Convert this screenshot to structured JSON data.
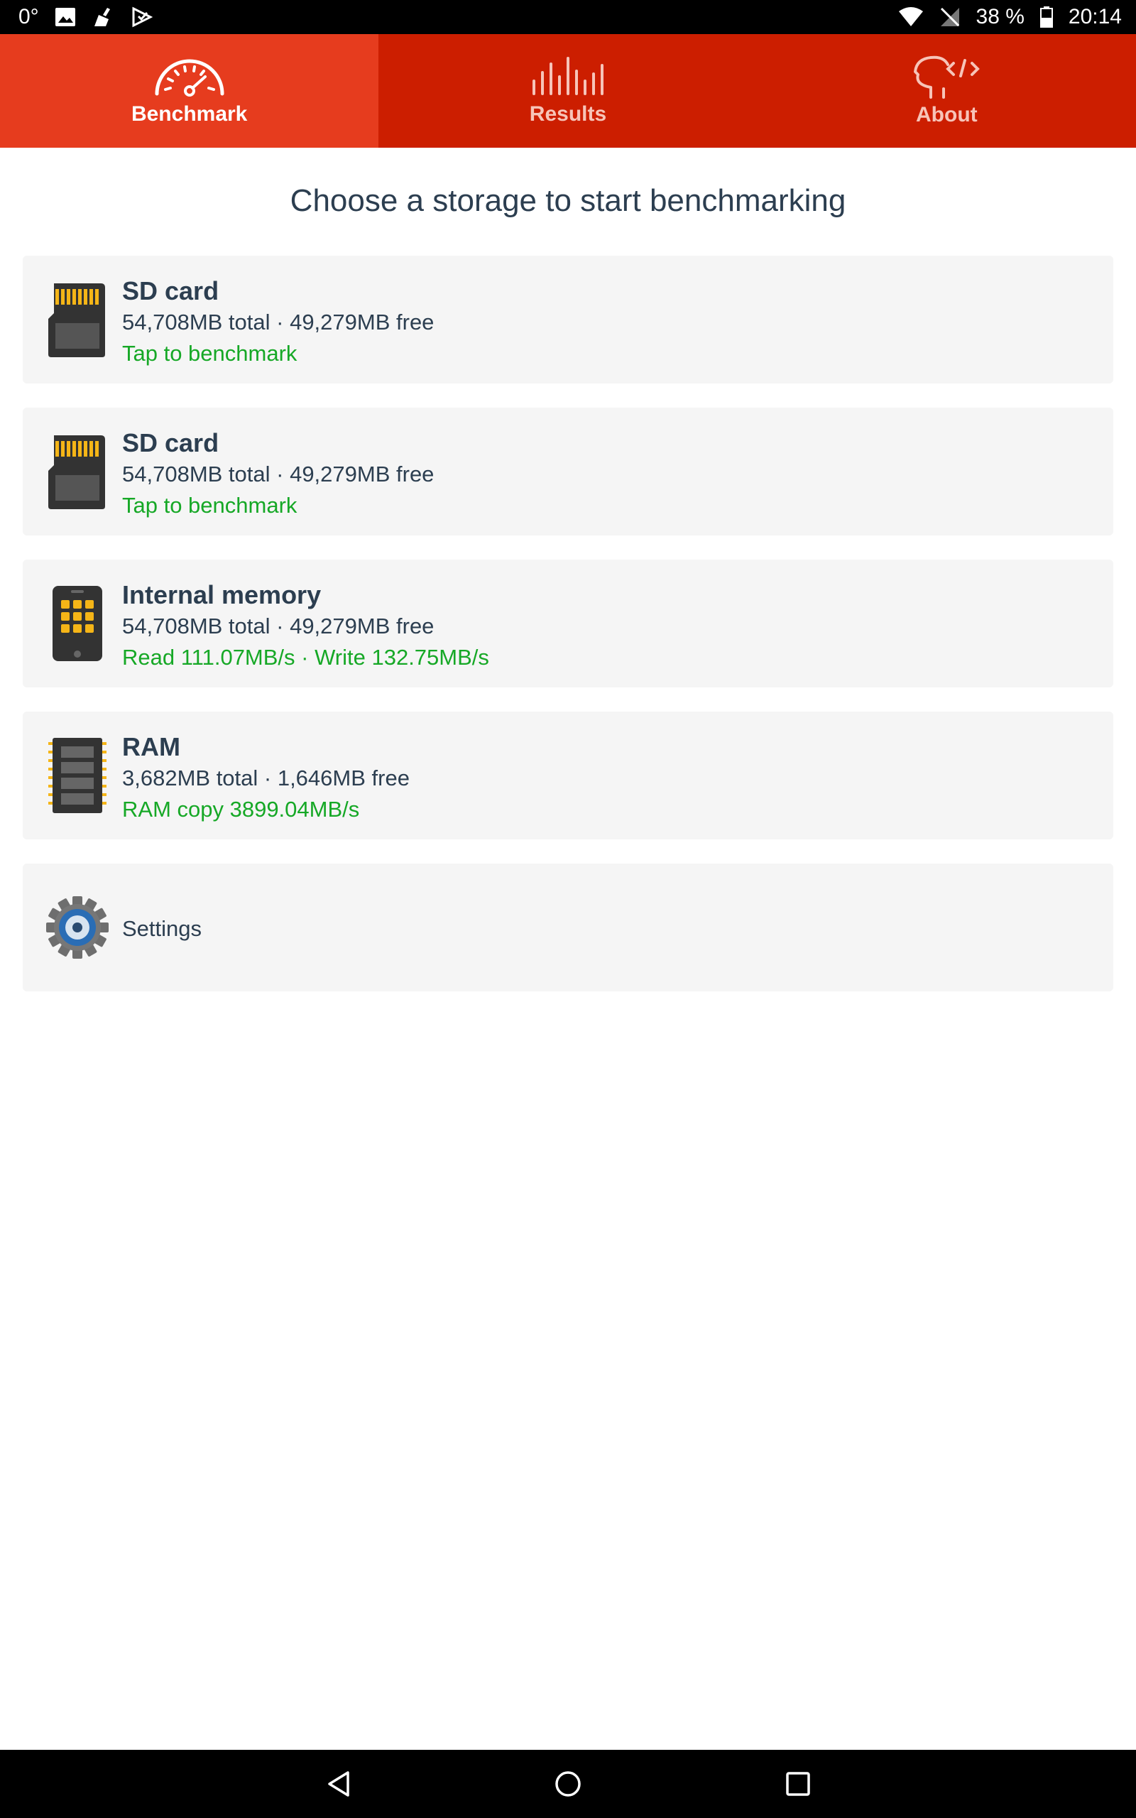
{
  "status_bar": {
    "temperature": "0°",
    "battery": "38 %",
    "time": "20:14"
  },
  "tabs": [
    {
      "label": "Benchmark",
      "icon": "speedometer-icon",
      "active": true
    },
    {
      "label": "Results",
      "icon": "bar-chart-icon",
      "active": false
    },
    {
      "label": "About",
      "icon": "head-code-icon",
      "active": false
    }
  ],
  "main": {
    "title": "Choose a storage to start benchmarking",
    "items": [
      {
        "name": "SD card",
        "detail": "54,708MB total · 49,279MB free",
        "status": "Tap to benchmark",
        "icon": "sd-card-icon"
      },
      {
        "name": "SD card",
        "detail": "54,708MB total · 49,279MB free",
        "status": "Tap to benchmark",
        "icon": "sd-card-icon"
      },
      {
        "name": "Internal memory",
        "detail": "54,708MB total · 49,279MB free",
        "status": "Read 111.07MB/s · Write 132.75MB/s",
        "icon": "phone-memory-icon"
      },
      {
        "name": "RAM",
        "detail": "3,682MB total · 1,646MB free",
        "status": "RAM copy 3899.04MB/s",
        "icon": "ram-chip-icon"
      }
    ],
    "settings": {
      "label": "Settings",
      "icon": "gear-icon"
    }
  },
  "colors": {
    "tab_active": "#e63c1e",
    "tab_inactive": "#cc1e00",
    "status_green": "#16a826",
    "card_bg": "#f5f5f5",
    "text_dark": "#2c3e50"
  }
}
